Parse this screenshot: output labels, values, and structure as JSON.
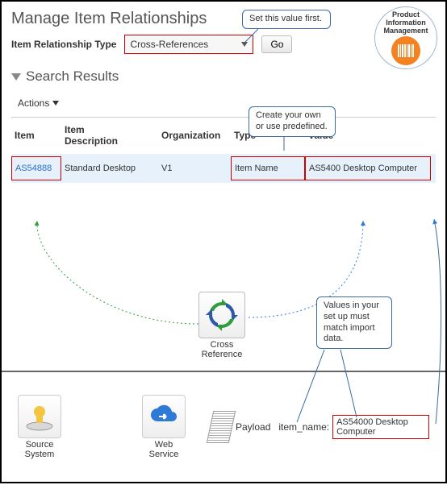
{
  "title": "Manage Item Relationships",
  "selector": {
    "label": "Item Relationship Type",
    "value": "Cross-References",
    "go": "Go"
  },
  "annotations": {
    "set_first": "Set this value first.",
    "create_own": "Create your own\nor use predefined.",
    "values_match": "Values in your\nset up must\nmatch import\ndata."
  },
  "pim": {
    "line1": "Product",
    "line2": "Information",
    "line3": "Management"
  },
  "search": {
    "heading": "Search Results",
    "actions": "Actions",
    "columns": {
      "item": "Item",
      "desc": "Item\nDescription",
      "org": "Organization",
      "type": "Type",
      "value": "Value"
    },
    "row": {
      "item": "AS54888",
      "desc": "Standard Desktop",
      "org": "V1",
      "type": "Item Name",
      "value": "AS5400 Desktop Computer"
    }
  },
  "cross_ref_label": "Cross\nReference",
  "bottom": {
    "source_system": "Source\nSystem",
    "web_service": "Web\nService",
    "payload": "Payload",
    "item_name_key": "item_name:",
    "item_name_val": "AS54000 Desktop Computer"
  }
}
